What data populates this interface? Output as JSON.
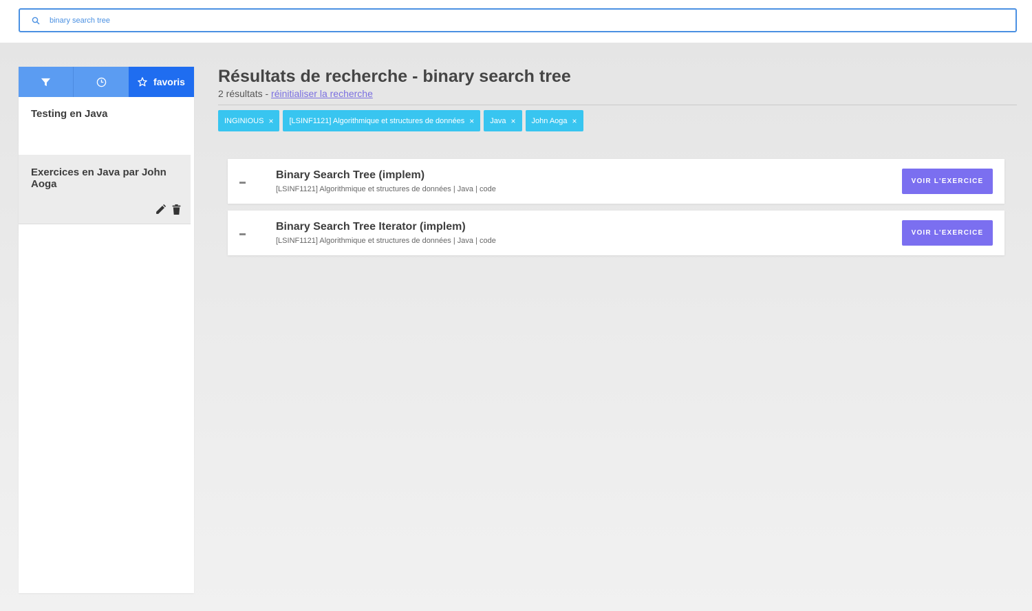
{
  "search": {
    "value": "binary search tree",
    "placeholder": ""
  },
  "sidebar": {
    "tabs": [
      {
        "icon": "filter-icon"
      },
      {
        "icon": "clock-icon"
      },
      {
        "icon": "star-icon",
        "label": "favoris"
      }
    ],
    "items": [
      {
        "title": "Testing en Java"
      },
      {
        "title": "Exercices en Java par John Aoga"
      }
    ]
  },
  "main": {
    "title": "Résultats de recherche - binary search tree",
    "count_text": "2 résultats - ",
    "reset_link": "réinitialiser la recherche",
    "filters": [
      {
        "label": "INGINIOUS",
        "remove": "×"
      },
      {
        "label": "[LSINF1121] Algorithmique et structures de données",
        "remove": "×"
      },
      {
        "label": "Java",
        "remove": "×"
      },
      {
        "label": "John Aoga",
        "remove": "×"
      }
    ],
    "results": [
      {
        "title": "Binary Search Tree (implem)",
        "meta": "[LSINF1121] Algorithmique et structures de données | Java | code",
        "button": "VOIR L'EXERCICE"
      },
      {
        "title": "Binary Search Tree Iterator (implem)",
        "meta": "[LSINF1121] Algorithmique et structures de données | Java | code",
        "button": "VOIR L'EXERCICE"
      }
    ]
  },
  "colors": {
    "accent_blue": "#1f6df0",
    "chip": "#38c5f0",
    "button": "#7b6ff0",
    "link": "#7a6fe0"
  }
}
